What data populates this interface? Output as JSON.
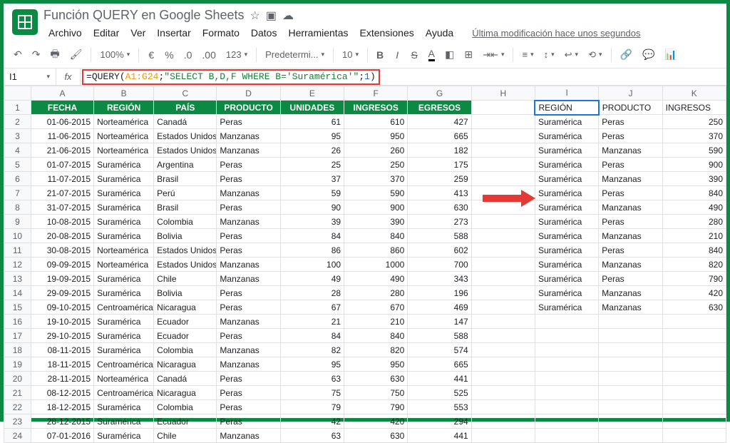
{
  "doc": {
    "title": "Función QUERY en Google Sheets",
    "last_edit": "Última modificación hace unos segundos"
  },
  "menubar": [
    "Archivo",
    "Editar",
    "Ver",
    "Insertar",
    "Formato",
    "Datos",
    "Herramientas",
    "Extensiones",
    "Ayuda"
  ],
  "toolbar": {
    "zoom": "100%",
    "font": "Predetermi...",
    "size": "10"
  },
  "formula": {
    "cell": "I1",
    "fn": "QUERY",
    "range": "A1:G24",
    "str": "\"SELECT B,D,F WHERE B='Suramérica'\"",
    "headers": "1"
  },
  "cols": [
    "",
    "A",
    "B",
    "C",
    "D",
    "E",
    "F",
    "G",
    "H",
    "I",
    "J",
    "K"
  ],
  "main_headers": [
    "FECHA",
    "REGIÓN",
    "PAÍS",
    "PRODUCTO",
    "UNIDADES",
    "INGRESOS",
    "EGRESOS"
  ],
  "result_headers": [
    "REGIÓN",
    "PRODUCTO",
    "INGRESOS"
  ],
  "rows": [
    [
      "01-06-2015",
      "Norteamérica",
      "Canadá",
      "Peras",
      "61",
      "610",
      "427"
    ],
    [
      "11-06-2015",
      "Norteamérica",
      "Estados Unidos",
      "Manzanas",
      "95",
      "950",
      "665"
    ],
    [
      "21-06-2015",
      "Norteamérica",
      "Estados Unidos",
      "Manzanas",
      "26",
      "260",
      "182"
    ],
    [
      "01-07-2015",
      "Suramérica",
      "Argentina",
      "Peras",
      "25",
      "250",
      "175"
    ],
    [
      "11-07-2015",
      "Suramérica",
      "Brasil",
      "Peras",
      "37",
      "370",
      "259"
    ],
    [
      "21-07-2015",
      "Suramérica",
      "Perú",
      "Manzanas",
      "59",
      "590",
      "413"
    ],
    [
      "31-07-2015",
      "Suramérica",
      "Brasil",
      "Peras",
      "90",
      "900",
      "630"
    ],
    [
      "10-08-2015",
      "Suramérica",
      "Colombia",
      "Manzanas",
      "39",
      "390",
      "273"
    ],
    [
      "20-08-2015",
      "Suramérica",
      "Bolivia",
      "Peras",
      "84",
      "840",
      "588"
    ],
    [
      "30-08-2015",
      "Norteamérica",
      "Estados Unidos",
      "Peras",
      "86",
      "860",
      "602"
    ],
    [
      "09-09-2015",
      "Norteamérica",
      "Estados Unidos",
      "Manzanas",
      "100",
      "1000",
      "700"
    ],
    [
      "19-09-2015",
      "Suramérica",
      "Chile",
      "Manzanas",
      "49",
      "490",
      "343"
    ],
    [
      "29-09-2015",
      "Suramérica",
      "Bolivia",
      "Peras",
      "28",
      "280",
      "196"
    ],
    [
      "09-10-2015",
      "Centroamérica",
      "Nicaragua",
      "Peras",
      "67",
      "670",
      "469"
    ],
    [
      "19-10-2015",
      "Suramérica",
      "Ecuador",
      "Manzanas",
      "21",
      "210",
      "147"
    ],
    [
      "29-10-2015",
      "Suramérica",
      "Ecuador",
      "Peras",
      "84",
      "840",
      "588"
    ],
    [
      "08-11-2015",
      "Suramérica",
      "Colombia",
      "Manzanas",
      "82",
      "820",
      "574"
    ],
    [
      "18-11-2015",
      "Centroamérica",
      "Nicaragua",
      "Manzanas",
      "95",
      "950",
      "665"
    ],
    [
      "28-11-2015",
      "Norteamérica",
      "Canadá",
      "Peras",
      "63",
      "630",
      "441"
    ],
    [
      "08-12-2015",
      "Centroamérica",
      "Nicaragua",
      "Peras",
      "75",
      "750",
      "525"
    ],
    [
      "18-12-2015",
      "Suramérica",
      "Colombia",
      "Peras",
      "79",
      "790",
      "553"
    ],
    [
      "28-12-2015",
      "Suramérica",
      "Ecuador",
      "Peras",
      "42",
      "420",
      "294"
    ],
    [
      "07-01-2016",
      "Suramérica",
      "Chile",
      "Manzanas",
      "63",
      "630",
      "441"
    ]
  ],
  "results": [
    [
      "Suramérica",
      "Peras",
      "250"
    ],
    [
      "Suramérica",
      "Peras",
      "370"
    ],
    [
      "Suramérica",
      "Manzanas",
      "590"
    ],
    [
      "Suramérica",
      "Peras",
      "900"
    ],
    [
      "Suramérica",
      "Manzanas",
      "390"
    ],
    [
      "Suramérica",
      "Peras",
      "840"
    ],
    [
      "Suramérica",
      "Manzanas",
      "490"
    ],
    [
      "Suramérica",
      "Peras",
      "280"
    ],
    [
      "Suramérica",
      "Manzanas",
      "210"
    ],
    [
      "Suramérica",
      "Peras",
      "840"
    ],
    [
      "Suramérica",
      "Manzanas",
      "820"
    ],
    [
      "Suramérica",
      "Peras",
      "790"
    ],
    [
      "Suramérica",
      "Manzanas",
      "420"
    ],
    [
      "Suramérica",
      "Manzanas",
      "630"
    ]
  ]
}
